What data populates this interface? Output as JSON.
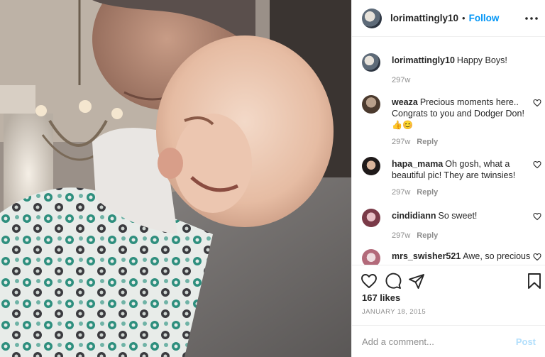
{
  "header": {
    "username": "lorimattingly10",
    "separator": "•",
    "follow_label": "Follow",
    "more_label": "•••"
  },
  "caption": {
    "username": "lorimattingly10",
    "text": "Happy Boys!",
    "age": "297w"
  },
  "comments": [
    {
      "username": "weaza",
      "text": "Precious moments here.. Congrats to you and Dodger Don!",
      "emoji": "👍😊",
      "age": "297w",
      "reply_label": "Reply"
    },
    {
      "username": "hapa_mama",
      "text": "Oh gosh, what a beautiful pic! They are twinsies!",
      "age": "297w",
      "reply_label": "Reply"
    },
    {
      "username": "cindidiann",
      "text": "So sweet!",
      "age": "297w",
      "reply_label": "Reply"
    },
    {
      "username": "mrs_swisher521",
      "text": "Awe, so precious"
    }
  ],
  "actions": {
    "like_icon": "heart-icon",
    "comment_icon": "comment-icon",
    "share_icon": "send-icon",
    "save_icon": "bookmark-icon"
  },
  "likes": "167 likes",
  "date": "JANUARY 18, 2015",
  "add_comment": {
    "placeholder": "Add a comment...",
    "post_label": "Post"
  },
  "colors": {
    "accent": "#0095f6",
    "post_disabled": "#b2dffc",
    "muted_text": "#8e8e8e",
    "border": "#efefef"
  }
}
